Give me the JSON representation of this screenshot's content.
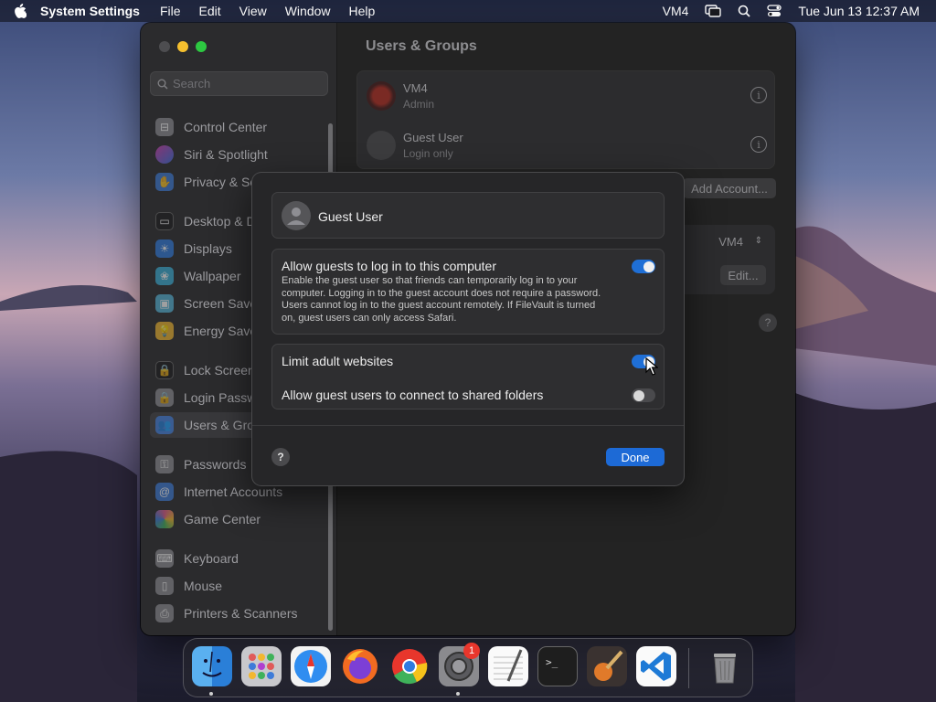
{
  "menubar": {
    "app_name": "System Settings",
    "menus": [
      "File",
      "Edit",
      "View",
      "Window",
      "Help"
    ],
    "status_user": "VM4",
    "datetime": "Tue Jun 13  12:37 AM"
  },
  "sidebar": {
    "search_placeholder": "Search",
    "items": [
      {
        "label": "Control Center",
        "icon": "control-center-icon",
        "color": "#8e8e93"
      },
      {
        "label": "Siri & Spotlight",
        "icon": "siri-icon",
        "color": "#b03fd0"
      },
      {
        "label": "Privacy & Security",
        "icon": "privacy-hand-icon",
        "color": "#3d7bd9"
      },
      {
        "label": "Desktop & Dock",
        "icon": "desktop-dock-icon",
        "color": "#2c2c2e"
      },
      {
        "label": "Displays",
        "icon": "displays-icon",
        "color": "#2f7be0"
      },
      {
        "label": "Wallpaper",
        "icon": "wallpaper-icon",
        "color": "#3ab0d8"
      },
      {
        "label": "Screen Saver",
        "icon": "screen-saver-icon",
        "color": "#56b5d9"
      },
      {
        "label": "Energy Saver",
        "icon": "energy-saver-icon",
        "color": "#f2b730"
      },
      {
        "label": "Lock Screen",
        "icon": "lock-screen-icon",
        "color": "#2c2c2e"
      },
      {
        "label": "Login Password",
        "icon": "login-password-icon",
        "color": "#8e8e93"
      },
      {
        "label": "Users & Groups",
        "icon": "users-groups-icon",
        "color": "#3d7bd9"
      },
      {
        "label": "Passwords",
        "icon": "passwords-key-icon",
        "color": "#8e8e93"
      },
      {
        "label": "Internet Accounts",
        "icon": "internet-accounts-icon",
        "color": "#3d7bd9"
      },
      {
        "label": "Game Center",
        "icon": "game-center-icon",
        "color": "#e05a8a"
      },
      {
        "label": "Keyboard",
        "icon": "keyboard-icon",
        "color": "#8e8e93"
      },
      {
        "label": "Mouse",
        "icon": "mouse-icon",
        "color": "#8e8e93"
      },
      {
        "label": "Printers & Scanners",
        "icon": "printer-icon",
        "color": "#8e8e93"
      }
    ]
  },
  "content": {
    "title": "Users & Groups",
    "users": [
      {
        "name": "VM4",
        "role": "Admin"
      },
      {
        "name": "Guest User",
        "role": "Login only"
      }
    ],
    "add_account_label": "Add Account...",
    "autologin_value": "VM4",
    "edit_label": "Edit..."
  },
  "dialog": {
    "user_name": "Guest User",
    "allow_guests": {
      "title": "Allow guests to log in to this computer",
      "description": "Enable the guest user so that friends can temporarily log in to your computer. Logging in to the guest account does not require a password. Users cannot log in to the guest account remotely. If FileVault is turned on, guest users can only access Safari.",
      "enabled": true
    },
    "limit_adult": {
      "title": "Limit adult websites",
      "enabled": true
    },
    "shared_folders": {
      "title": "Allow guest users to connect to shared folders",
      "enabled": false
    },
    "help_label": "?",
    "done_label": "Done"
  },
  "dock": {
    "apps": [
      "Finder",
      "Launchpad",
      "Safari",
      "Firefox",
      "Chrome",
      "System Settings",
      "TextEdit",
      "Terminal",
      "GarageBand",
      "Visual Studio Code",
      "Trash"
    ],
    "settings_badge": "1"
  },
  "colors": {
    "accent": "#1f6fd6",
    "window_bg": "#232323",
    "dialog_bg": "#262628"
  }
}
